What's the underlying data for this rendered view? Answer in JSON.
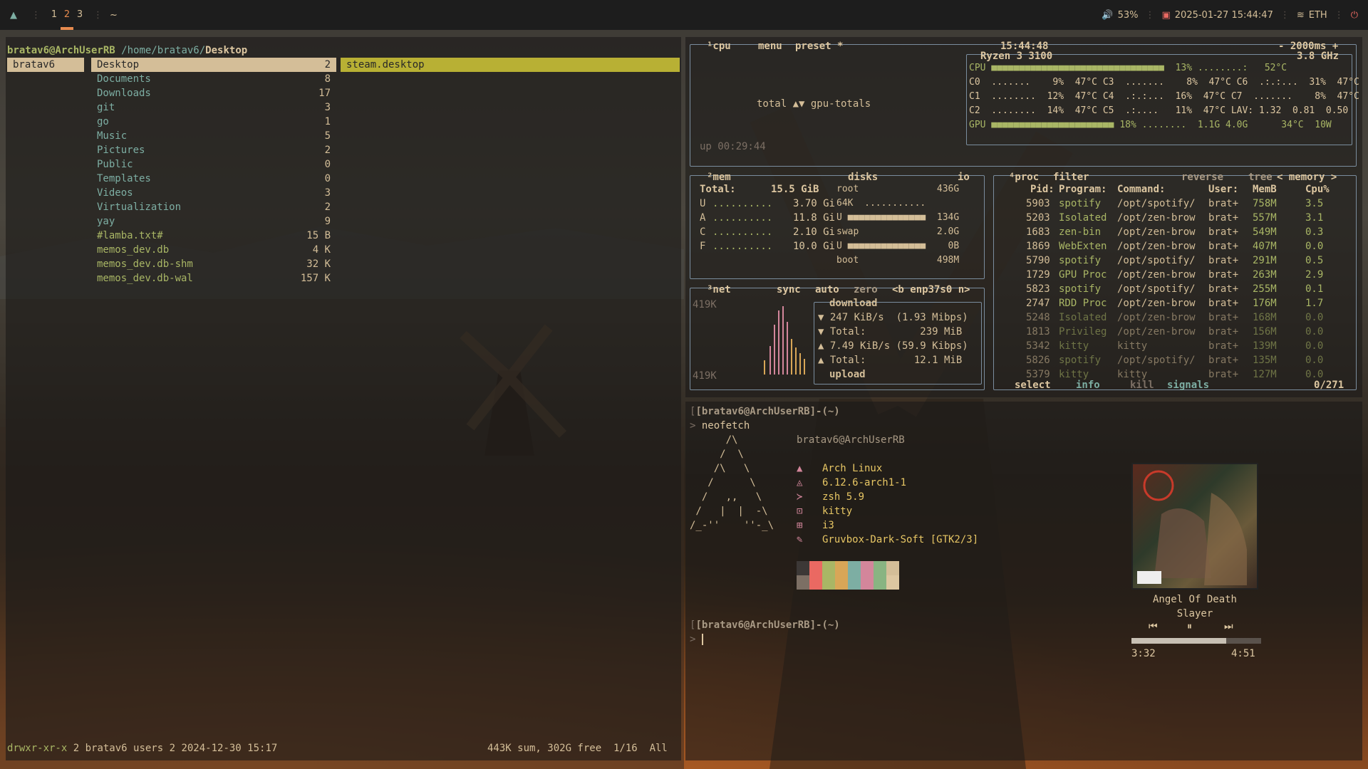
{
  "topbar": {
    "workspaces": [
      "1",
      "2",
      "3"
    ],
    "active_ws": "2",
    "home": "~",
    "volume": "53%",
    "datetime": "2025-01-27 15:44:47",
    "net": "ETH"
  },
  "ranger": {
    "path_user": "bratav6@ArchUserRB",
    "path_dir": "/home/bratav6/",
    "path_cur": "Desktop",
    "parent": "bratav6",
    "items": [
      {
        "n": "Desktop",
        "c": "2"
      },
      {
        "n": "Documents",
        "c": "8"
      },
      {
        "n": "Downloads",
        "c": "17"
      },
      {
        "n": "git",
        "c": "3"
      },
      {
        "n": "go",
        "c": "1"
      },
      {
        "n": "Music",
        "c": "5"
      },
      {
        "n": "Pictures",
        "c": "2"
      },
      {
        "n": "Public",
        "c": "0"
      },
      {
        "n": "Templates",
        "c": "0"
      },
      {
        "n": "Videos",
        "c": "3"
      },
      {
        "n": "Virtualization",
        "c": "2"
      },
      {
        "n": "yay",
        "c": "9"
      },
      {
        "n": "#lamba.txt#",
        "c": "15 B"
      },
      {
        "n": "memos_dev.db",
        "c": "4 K"
      },
      {
        "n": "memos_dev.db-shm",
        "c": "32 K"
      },
      {
        "n": "memos_dev.db-wal",
        "c": "157 K"
      }
    ],
    "preview": "steam.desktop",
    "status_perm": "drwxr-xr-x",
    "status_info": "2 bratav6 users 2 2024-12-30 15:17",
    "status_right": "443K sum, 302G free  1/16  All"
  },
  "btop": {
    "cpu": {
      "tabs": [
        "¹cpu",
        "menu",
        "preset *"
      ],
      "clock": "15:44:48",
      "rate": "- 2000ms +",
      "model": "Ryzen 3 3100",
      "freq": "3.8 GHz",
      "total": "total ▲▼ gpu-totals",
      "uptime": "up 00:29:44",
      "rows": [
        "CPU ■■■■■■■■■■■■■■■■■■■■■■■■■■■■■■■  13% ........:   52°C",
        "C0  .......    9%  47°C C3  .......    8%  47°C C6  .:.:...  31%  47°C",
        "C1  ........  12%  47°C C4  .:.:...  16%  47°C C7  .......    8%  47°C",
        "C2  ........  14%  47°C C5  .:....   11%  47°C LAV: 1.32  0.81  0.50",
        "GPU ■■■■■■■■■■■■■■■■■■■■■■ 18% ........  1.1G 4.0G      34°C  10W"
      ]
    },
    "mem": {
      "title": "²mem",
      "disks": "disks",
      "io": "io",
      "total_label": "Total:",
      "total": "15.5 GiB",
      "rows": [
        {
          "k": "U",
          "v": "3.70 Gi"
        },
        {
          "k": "A",
          "v": "11.8 Gi"
        },
        {
          "k": "C",
          "v": "2.10 Gi"
        },
        {
          "k": "F",
          "v": "10.0 Gi"
        }
      ],
      "disk_rows": [
        "root              436G",
        "64K  ...........  ",
        "U ■■■■■■■■■■■■■■  134G",
        "swap              2.0G",
        "U ■■■■■■■■■■■■■■    0B",
        "boot              498M"
      ]
    },
    "net": {
      "title": "³net",
      "sync": "sync",
      "auto": "auto",
      "zero": "zero",
      "iface": "<b enp37s0 n>",
      "scale_top": "419K",
      "scale_bot": "419K",
      "rows": [
        "download",
        "▼ 247 KiB/s  (1.93 Mibps)",
        "▼ Total:         239 MiB",
        "▲ 7.49 KiB/s (59.9 Kibps)",
        "▲ Total:        12.1 MiB",
        "upload"
      ]
    },
    "proc": {
      "title": "⁴proc",
      "filter": "filter",
      "reverse": "reverse",
      "tree": "tree",
      "sort": "< memory >",
      "headers": [
        "Pid:",
        "Program:",
        "Command:",
        "User:",
        "MemB",
        "Cpu%"
      ],
      "rows": [
        {
          "pid": "5903",
          "prog": "spotify",
          "cmd": "/opt/spotify/",
          "user": "brat+",
          "mem": "758M",
          "cpu": "3.5"
        },
        {
          "pid": "5203",
          "prog": "Isolated",
          "cmd": "/opt/zen-brow",
          "user": "brat+",
          "mem": "557M",
          "cpu": "3.1"
        },
        {
          "pid": "1683",
          "prog": "zen-bin",
          "cmd": "/opt/zen-brow",
          "user": "brat+",
          "mem": "549M",
          "cpu": "0.3"
        },
        {
          "pid": "1869",
          "prog": "WebExten",
          "cmd": "/opt/zen-brow",
          "user": "brat+",
          "mem": "407M",
          "cpu": "0.0"
        },
        {
          "pid": "5790",
          "prog": "spotify",
          "cmd": "/opt/spotify/",
          "user": "brat+",
          "mem": "291M",
          "cpu": "0.5"
        },
        {
          "pid": "1729",
          "prog": "GPU Proc",
          "cmd": "/opt/zen-brow",
          "user": "brat+",
          "mem": "263M",
          "cpu": "2.9"
        },
        {
          "pid": "5823",
          "prog": "spotify",
          "cmd": "/opt/spotify/",
          "user": "brat+",
          "mem": "255M",
          "cpu": "0.1"
        },
        {
          "pid": "2747",
          "prog": "RDD Proc",
          "cmd": "/opt/zen-brow",
          "user": "brat+",
          "mem": "176M",
          "cpu": "1.7"
        },
        {
          "pid": "5248",
          "prog": "Isolated",
          "cmd": "/opt/zen-brow",
          "user": "brat+",
          "mem": "168M",
          "cpu": "0.0"
        },
        {
          "pid": "1813",
          "prog": "Privileg",
          "cmd": "/opt/zen-brow",
          "user": "brat+",
          "mem": "156M",
          "cpu": "0.0"
        },
        {
          "pid": "5342",
          "prog": "kitty",
          "cmd": "kitty",
          "user": "brat+",
          "mem": "139M",
          "cpu": "0.0"
        },
        {
          "pid": "5826",
          "prog": "spotify",
          "cmd": "/opt/spotify/",
          "user": "brat+",
          "mem": "135M",
          "cpu": "0.0"
        },
        {
          "pid": "5379",
          "prog": "kitty",
          "cmd": "kitty",
          "user": "brat+",
          "mem": "127M",
          "cpu": "0.0"
        }
      ],
      "footer_select": "select",
      "footer_info": "info",
      "footer_kill": "kill",
      "footer_signals": "signals",
      "count": "0/271"
    }
  },
  "kitty": {
    "prompt": "[bratav6@ArchUserRB]-(~)",
    "cmd": "neofetch",
    "userhost": "bratav6@ArchUserRB",
    "logo": [
      "      /\\",
      "     /  \\",
      "    /\\   \\",
      "   /      \\",
      "  /   ,,   \\",
      " /   |  |  -\\",
      "/_-''    ''-_\\"
    ],
    "info": [
      {
        "icon": "arch-icon",
        "v": "Arch Linux"
      },
      {
        "icon": "kernel-icon",
        "v": "6.12.6-arch1-1"
      },
      {
        "icon": "shell-icon",
        "v": "zsh 5.9"
      },
      {
        "icon": "terminal-icon",
        "v": "kitty"
      },
      {
        "icon": "wm-icon",
        "v": "i3"
      },
      {
        "icon": "theme-icon",
        "v": "Gruvbox-Dark-Soft [GTK2/3]"
      }
    ],
    "prompt2": "[bratav6@ArchUserRB]-(~)",
    "prompt_symbol": "> "
  },
  "player": {
    "title": "Angel Of Death",
    "artist": "Slayer",
    "elapsed": "3:32",
    "total": "4:51",
    "progress": 0.73
  },
  "colors": {
    "accent": "#e78a4e",
    "green": "#a9b665",
    "yellow": "#d8a657",
    "border": "#7a8d9e"
  }
}
